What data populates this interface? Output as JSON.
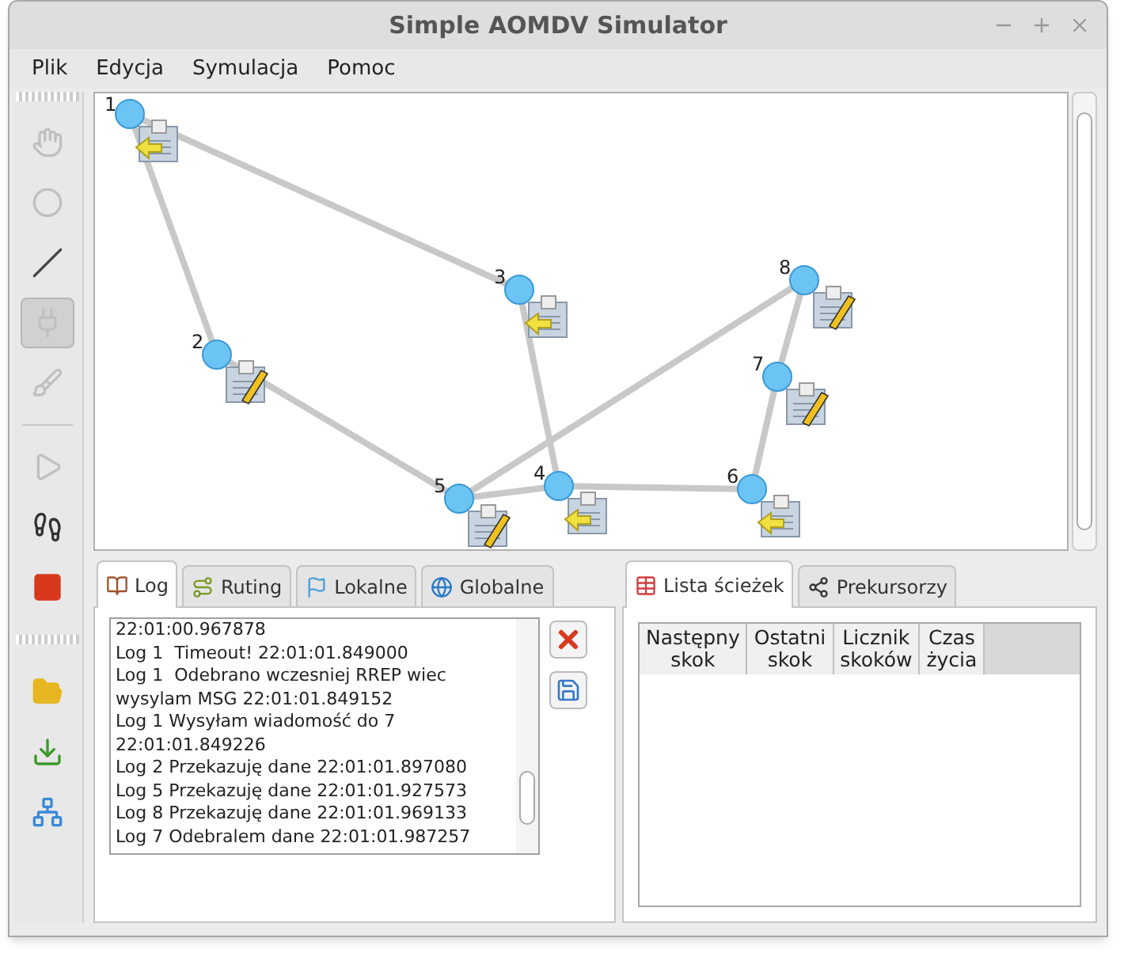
{
  "window": {
    "title": "Simple AOMDV Simulator"
  },
  "menu": [
    "Plik",
    "Edycja",
    "Symulacja",
    "Pomoc"
  ],
  "toolbar": [
    {
      "kind": "hand",
      "selected": false,
      "disabled": true
    },
    {
      "kind": "node",
      "selected": false,
      "disabled": true
    },
    {
      "kind": "line",
      "selected": false,
      "disabled": false
    },
    {
      "kind": "plug",
      "selected": true,
      "disabled": true
    },
    {
      "kind": "brush",
      "selected": false,
      "disabled": true
    },
    {
      "kind": "separator"
    },
    {
      "kind": "play",
      "selected": false,
      "disabled": true
    },
    {
      "kind": "step",
      "selected": false,
      "disabled": false
    },
    {
      "kind": "stop",
      "selected": false,
      "disabled": false
    },
    {
      "kind": "grip"
    },
    {
      "kind": "open",
      "selected": false,
      "disabled": false
    },
    {
      "kind": "download",
      "selected": false,
      "disabled": false
    },
    {
      "kind": "network",
      "selected": false,
      "disabled": false
    }
  ],
  "canvas": {
    "nodes": [
      {
        "label": "1",
        "kind": "arrow"
      },
      {
        "label": "2",
        "kind": "pencil"
      },
      {
        "label": "3",
        "kind": "arrow"
      },
      {
        "label": "4",
        "kind": "arrow"
      },
      {
        "label": "5",
        "kind": "pencil"
      },
      {
        "label": "6",
        "kind": "arrow"
      },
      {
        "label": "7",
        "kind": "pencil"
      },
      {
        "label": "8",
        "kind": "pencil"
      }
    ]
  },
  "left_tabs": [
    {
      "label": "Log",
      "kind": "book",
      "selected": true
    },
    {
      "label": "Ruting",
      "kind": "route",
      "selected": false
    },
    {
      "label": "Lokalne",
      "kind": "flag",
      "selected": false
    },
    {
      "label": "Globalne",
      "kind": "globe",
      "selected": false
    }
  ],
  "log": [
    "22:01:00.967878",
    "Log 1  Timeout! 22:01:01.849000",
    "Log 1  Odebrano wczesniej RREP wiec wysylam MSG 22:01:01.849152",
    "Log 1 Wysyłam wiadomość do 7 22:01:01.849226",
    "Log 2 Przekazuję dane 22:01:01.897080",
    "Log 5 Przekazuję dane 22:01:01.927573",
    "Log 8 Przekazuję dane 22:01:01.969133",
    "Log 7 Odebralem dane 22:01:01.987257"
  ],
  "right_tabs": [
    {
      "label": "Lista ścieżek",
      "kind": "table",
      "selected": true
    },
    {
      "label": "Prekursorzy",
      "kind": "share",
      "selected": false
    }
  ],
  "table": {
    "columns": [
      "Następny skok",
      "Ostatni skok",
      "Licznik skoków",
      "Czas życia"
    ]
  }
}
